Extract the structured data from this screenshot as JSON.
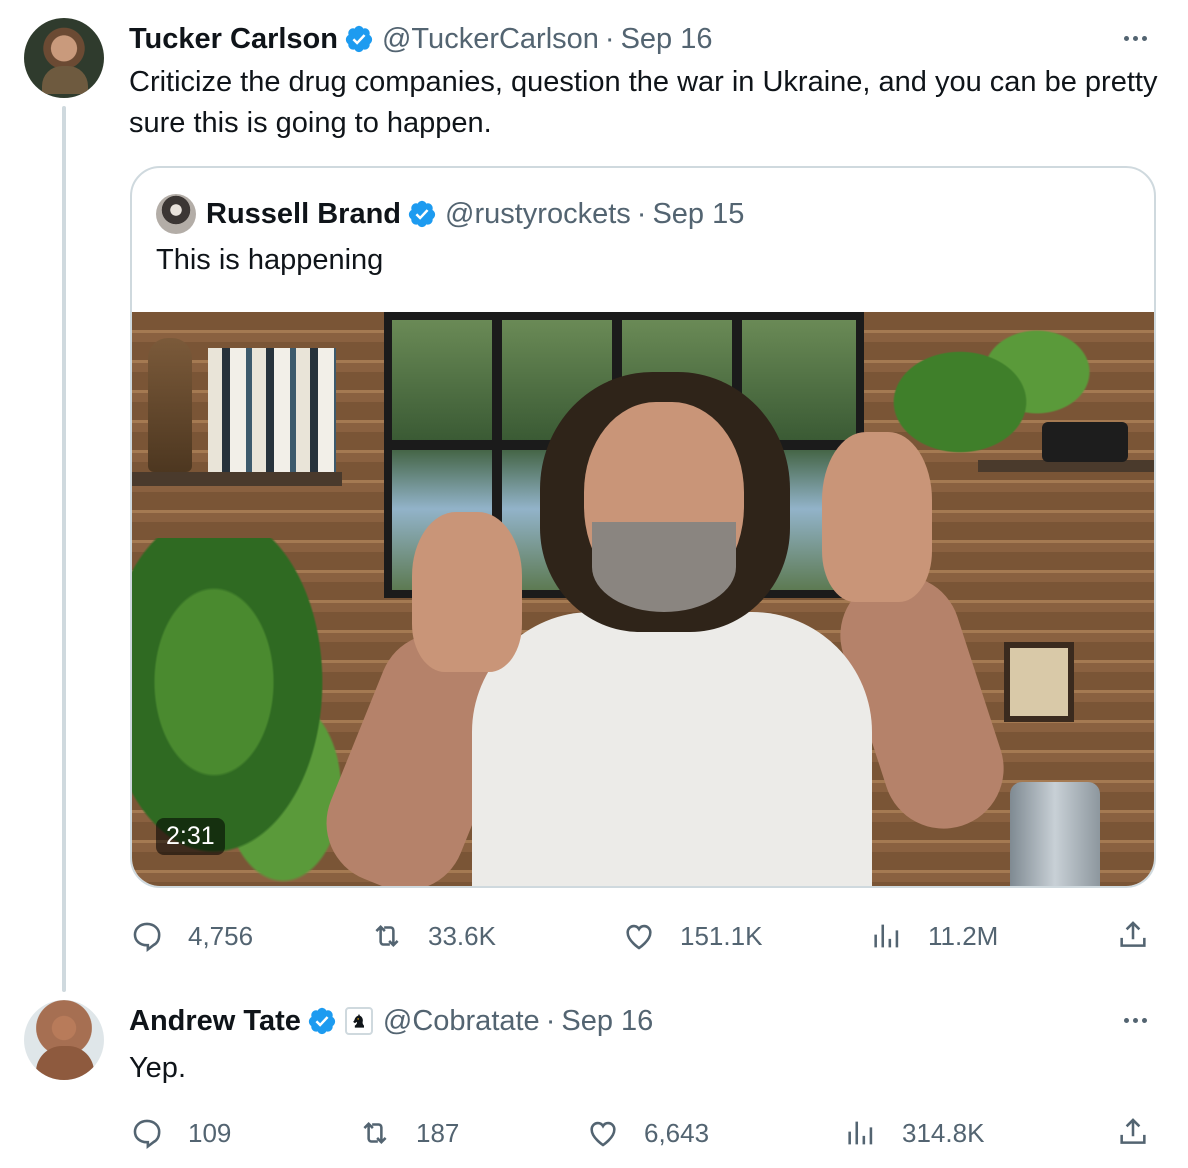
{
  "colors": {
    "text_primary": "#0f1419",
    "text_secondary": "#536471",
    "verified_blue": "#1d9bf0",
    "border": "#cfd9de"
  },
  "tweets": [
    {
      "display_name": "Tucker Carlson",
      "handle": "@TuckerCarlson",
      "separator": "·",
      "date": "Sep 16",
      "text": "Criticize the drug companies, question the war in Ukraine, and you can be pretty sure this is going to happen.",
      "avatar_icon": "avatar",
      "verified_icon": "verified-badge-icon",
      "more_icon": "more-options-icon",
      "actions": {
        "replies": "4,756",
        "reposts": "33.6K",
        "likes": "151.1K",
        "views": "11.2M"
      },
      "quote": {
        "display_name": "Russell Brand",
        "handle": "@rustyrockets",
        "separator": "·",
        "date": "Sep 15",
        "text": "This is happening",
        "video_duration": "2:31"
      }
    },
    {
      "display_name": "Andrew Tate",
      "handle": "@Cobratate",
      "separator": "·",
      "date": "Sep 16",
      "text": "Yep.",
      "affiliate_icon": "knight-chess-piece-icon",
      "actions": {
        "replies": "109",
        "reposts": "187",
        "likes": "6,643",
        "views": "314.8K"
      }
    }
  ]
}
